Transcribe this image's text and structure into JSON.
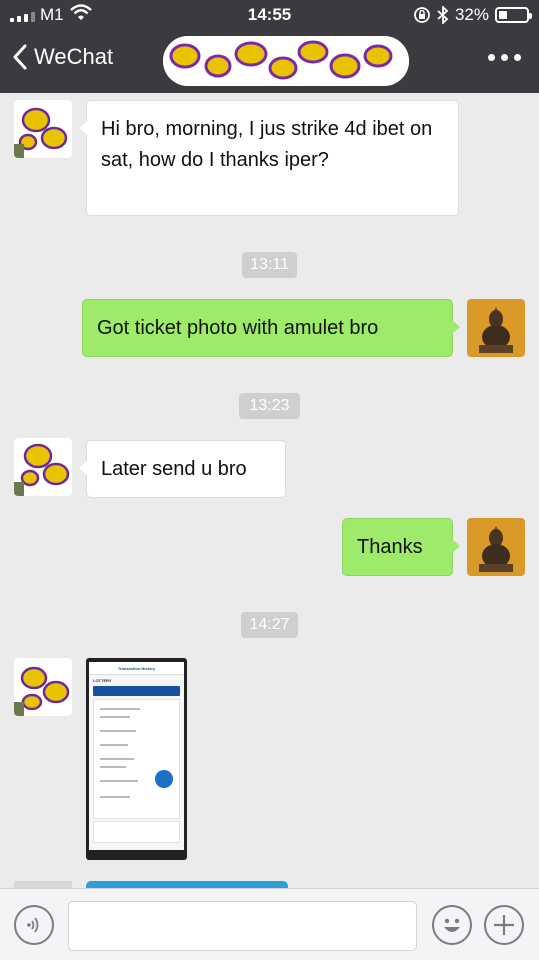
{
  "status_bar": {
    "carrier": "M1",
    "time": "14:55",
    "battery_percent": "32%",
    "battery_level": 0.32,
    "icons": [
      "signal-icon",
      "wifi-icon",
      "rotation-lock-icon",
      "bluetooth-icon",
      "battery-icon"
    ]
  },
  "nav": {
    "back_label": "WeChat",
    "title_obscured": true,
    "more_icon": "more-dots-icon"
  },
  "messages": [
    {
      "type": "incoming",
      "text": "Hi bro, morning, I jus strike 4d ibet on sat, how do I thanks iper?"
    },
    {
      "type": "timestamp",
      "text": "13:11"
    },
    {
      "type": "outgoing",
      "text": "Got ticket photo with amulet bro"
    },
    {
      "type": "timestamp",
      "text": "13:23"
    },
    {
      "type": "incoming",
      "text": "Later send u bro"
    },
    {
      "type": "outgoing",
      "text": "Thanks"
    },
    {
      "type": "timestamp",
      "text": "14:27"
    },
    {
      "type": "incoming-image",
      "text": ""
    }
  ],
  "photo": {
    "header": "Transaction History",
    "label": "LOTTERY"
  },
  "input_bar": {
    "voice_icon": "voice-icon",
    "emoji_icon": "emoji-icon",
    "plus_icon": "plus-icon",
    "text_value": ""
  },
  "colors": {
    "nav_bg": "#3a3a3f",
    "chat_bg": "#ebebeb",
    "outgoing_bubble": "#9eea6a",
    "incoming_bubble": "#ffffff",
    "timestamp_bg": "#cfcfcf"
  }
}
